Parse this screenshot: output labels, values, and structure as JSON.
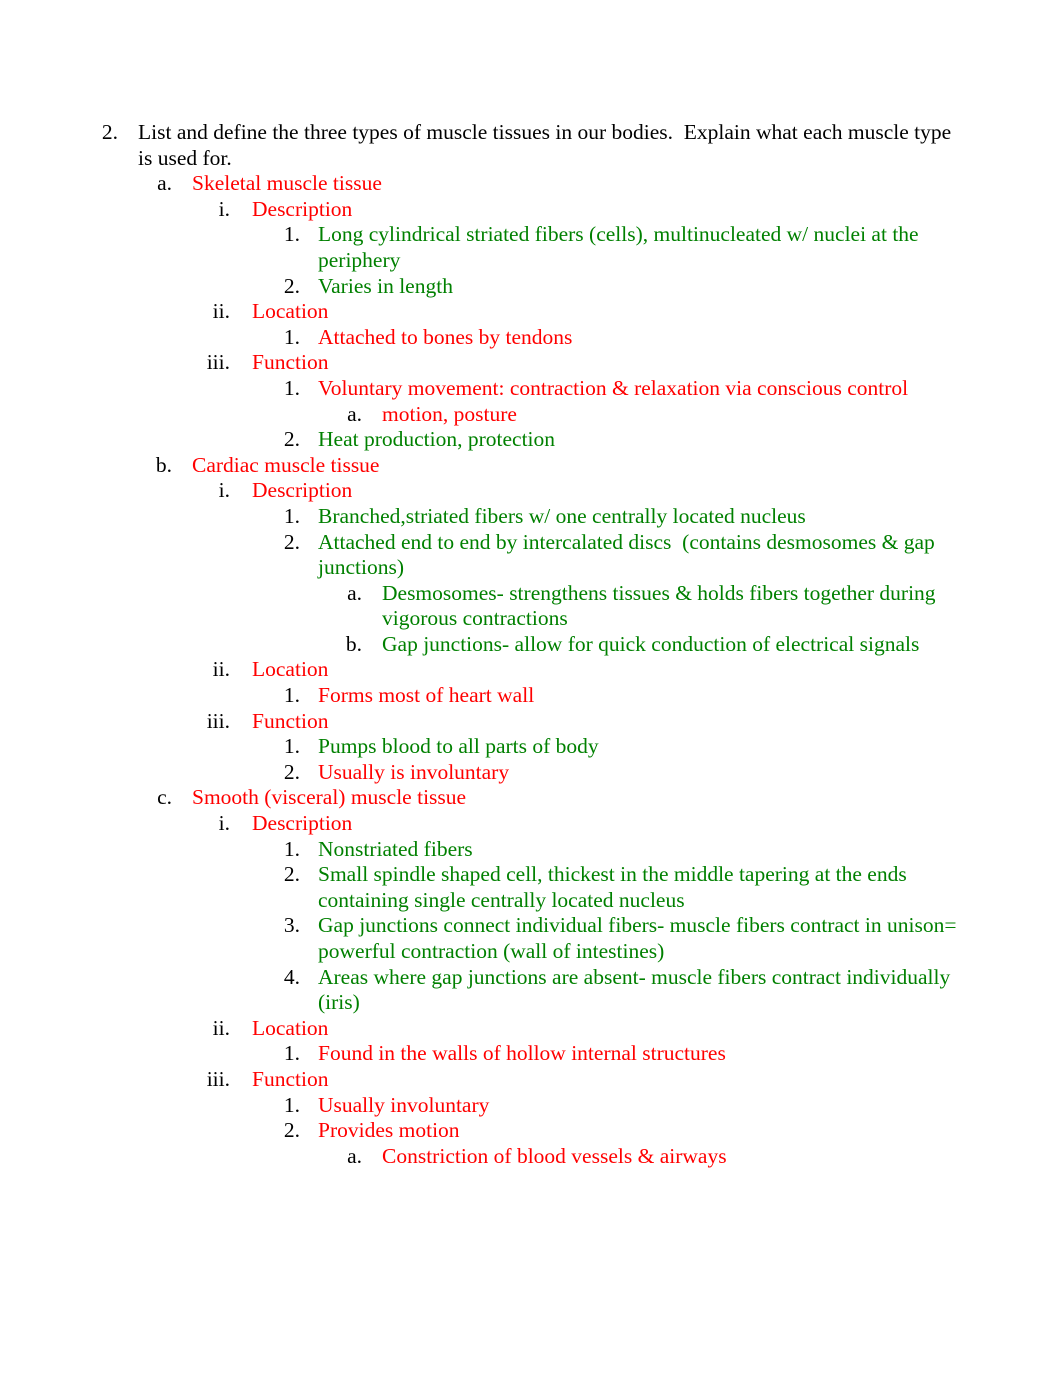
{
  "document": {
    "colors": {
      "black": "#000000",
      "red": "#FF0000",
      "green": "#008000",
      "page_background": "#FFFFFF"
    },
    "outline": [
      {
        "level": 1,
        "marker": "2.",
        "color": "black",
        "text": "List and define the three types of muscle tissues in our bodies.  Explain what each muscle type is used for."
      },
      {
        "level": 2,
        "marker": "a.",
        "color": "red",
        "text": "Skeletal muscle tissue"
      },
      {
        "level": 3,
        "marker": "i.",
        "color": "red",
        "text": "Description"
      },
      {
        "level": 4,
        "marker": "1.",
        "color": "green",
        "text": "Long cylindrical striated fibers (cells), multinucleated w/ nuclei at the periphery"
      },
      {
        "level": 4,
        "marker": "2.",
        "color": "green",
        "text": "Varies in length"
      },
      {
        "level": 3,
        "marker": "ii.",
        "color": "red",
        "text": "Location"
      },
      {
        "level": 4,
        "marker": "1.",
        "color": "red",
        "text": "Attached to bones by tendons"
      },
      {
        "level": 3,
        "marker": "iii.",
        "color": "red",
        "text": "Function"
      },
      {
        "level": 4,
        "marker": "1.",
        "color": "red",
        "text": "Voluntary movement: contraction & relaxation via conscious control"
      },
      {
        "level": 5,
        "marker": "a.",
        "color": "red",
        "text": "motion, posture"
      },
      {
        "level": 4,
        "marker": "2.",
        "color": "green",
        "text": "Heat production, protection"
      },
      {
        "level": 2,
        "marker": "b.",
        "color": "red",
        "text": "Cardiac muscle tissue"
      },
      {
        "level": 3,
        "marker": "i.",
        "color": "red",
        "text": "Description"
      },
      {
        "level": 4,
        "marker": "1.",
        "color": "green",
        "text": "Branched,striated fibers w/ one centrally located nucleus"
      },
      {
        "level": 4,
        "marker": "2.",
        "color": "green",
        "text": "Attached end to end by intercalated discs  (contains desmosomes & gap junctions)"
      },
      {
        "level": 5,
        "marker": "a.",
        "color": "green",
        "text": "Desmosomes- strengthens tissues & holds fibers together during vigorous contractions"
      },
      {
        "level": 5,
        "marker": "b.",
        "color": "green",
        "text": "Gap junctions- allow for quick conduction of electrical signals"
      },
      {
        "level": 3,
        "marker": "ii.",
        "color": "red",
        "text": "Location"
      },
      {
        "level": 4,
        "marker": "1.",
        "color": "red",
        "text": "Forms most of heart wall"
      },
      {
        "level": 3,
        "marker": "iii.",
        "color": "red",
        "text": "Function"
      },
      {
        "level": 4,
        "marker": "1.",
        "color": "green",
        "text": "Pumps blood to all parts of body"
      },
      {
        "level": 4,
        "marker": "2.",
        "color": "red",
        "text": "Usually is involuntary"
      },
      {
        "level": 2,
        "marker": "c.",
        "color": "red",
        "text": "Smooth (visceral) muscle tissue"
      },
      {
        "level": 3,
        "marker": "i.",
        "color": "red",
        "text": "Description"
      },
      {
        "level": 4,
        "marker": "1.",
        "color": "green",
        "text": "Nonstriated fibers"
      },
      {
        "level": 4,
        "marker": "2.",
        "color": "green",
        "text": "Small spindle shaped cell, thickest in the middle tapering at the ends containing single centrally located nucleus"
      },
      {
        "level": 4,
        "marker": "3.",
        "color": "green",
        "text": "Gap junctions connect individual fibers- muscle fibers contract in unison= powerful contraction (wall of intestines)"
      },
      {
        "level": 4,
        "marker": "4.",
        "color": "green",
        "text": "Areas where gap junctions are absent- muscle fibers contract individually  (iris)"
      },
      {
        "level": 3,
        "marker": "ii.",
        "color": "red",
        "text": "Location"
      },
      {
        "level": 4,
        "marker": "1.",
        "color": "red",
        "text": "Found in the walls of hollow internal structures"
      },
      {
        "level": 3,
        "marker": "iii.",
        "color": "red",
        "text": "Function"
      },
      {
        "level": 4,
        "marker": "1.",
        "color": "red",
        "text": "Usually involuntary"
      },
      {
        "level": 4,
        "marker": "2.",
        "color": "red",
        "text": "Provides motion"
      },
      {
        "level": 5,
        "marker": "a.",
        "color": "red",
        "text": "Constriction of blood vessels & airways"
      }
    ]
  }
}
